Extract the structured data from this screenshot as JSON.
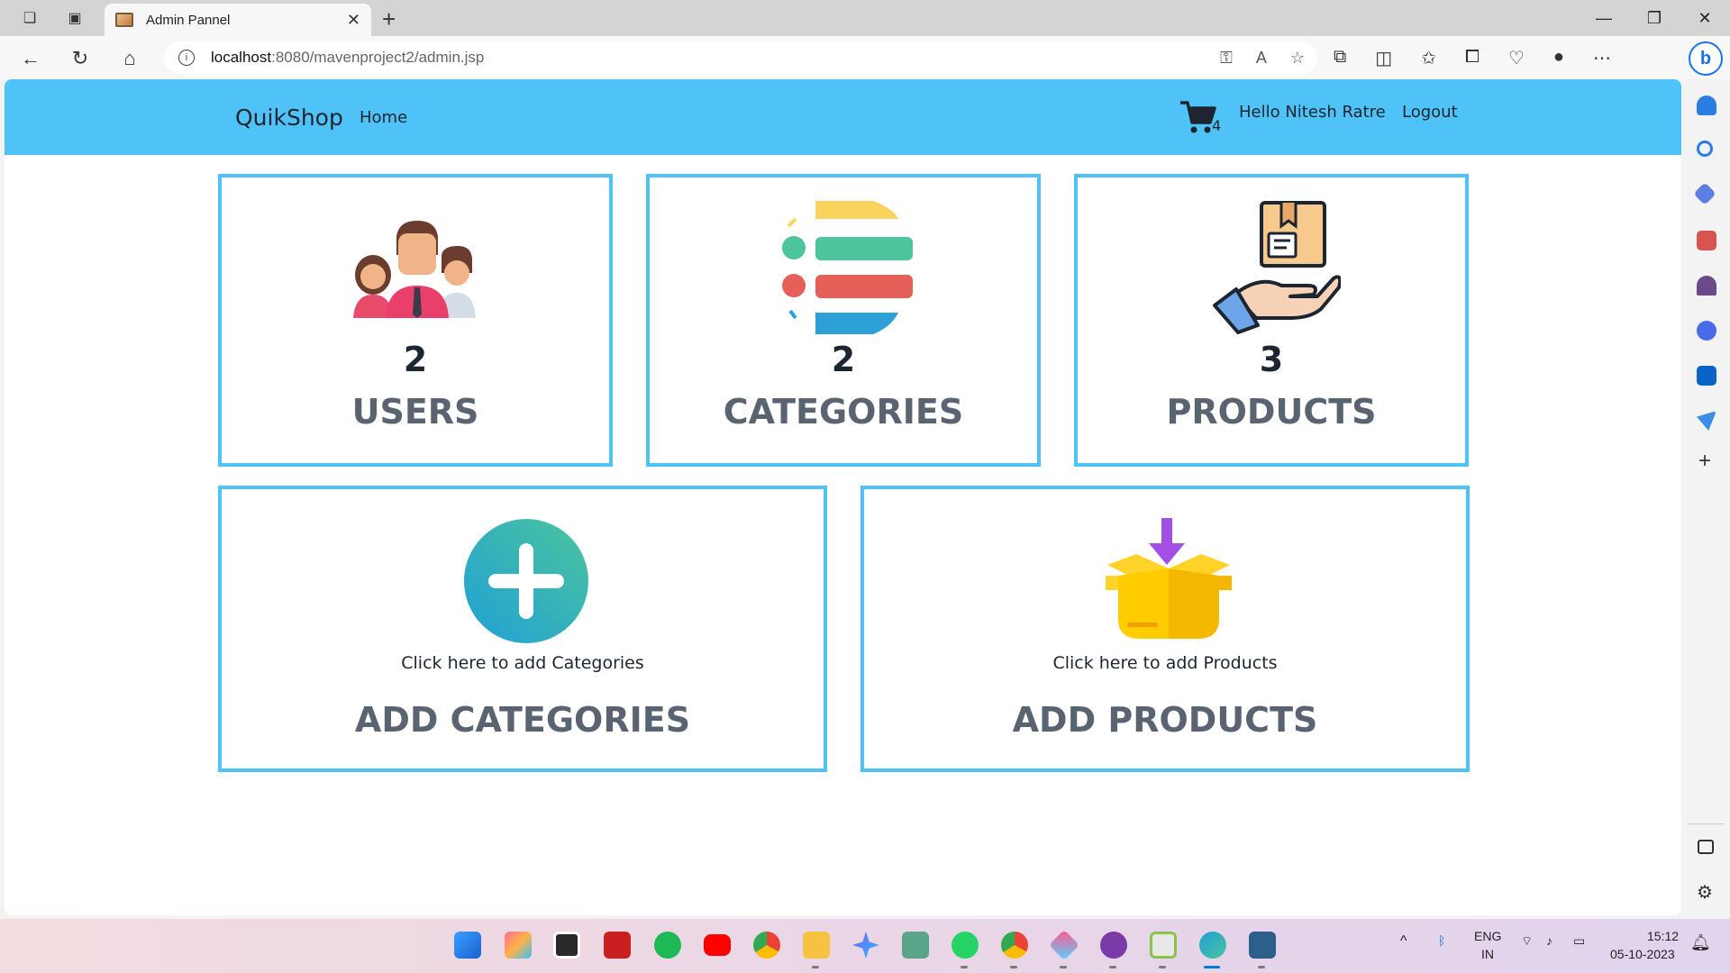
{
  "browser": {
    "tab_title": "Admin Pannel",
    "url_host": "localhost",
    "url_rest": ":8080/mavenproject2/admin.jsp"
  },
  "navbar": {
    "brand": "QuikShop",
    "home": "Home",
    "cart_count": "4",
    "greeting": "Hello Nitesh Ratre",
    "logout": "Logout"
  },
  "stats": [
    {
      "count": "2",
      "label": "USERS"
    },
    {
      "count": "2",
      "label": "CATEGORIES"
    },
    {
      "count": "3",
      "label": "PRODUCTS"
    }
  ],
  "actions": [
    {
      "hint": "Click here to add Categories",
      "label": "ADD CATEGORIES"
    },
    {
      "hint": "Click here to add Products",
      "label": "ADD PRODUCTS"
    }
  ],
  "taskbar": {
    "lang": "ENG",
    "region": "IN",
    "time": "15:12",
    "date": "05-10-2023"
  },
  "colors": {
    "accent": "#4fc3f7",
    "text_dark": "#1c2530",
    "label_gray": "#5a6470"
  }
}
